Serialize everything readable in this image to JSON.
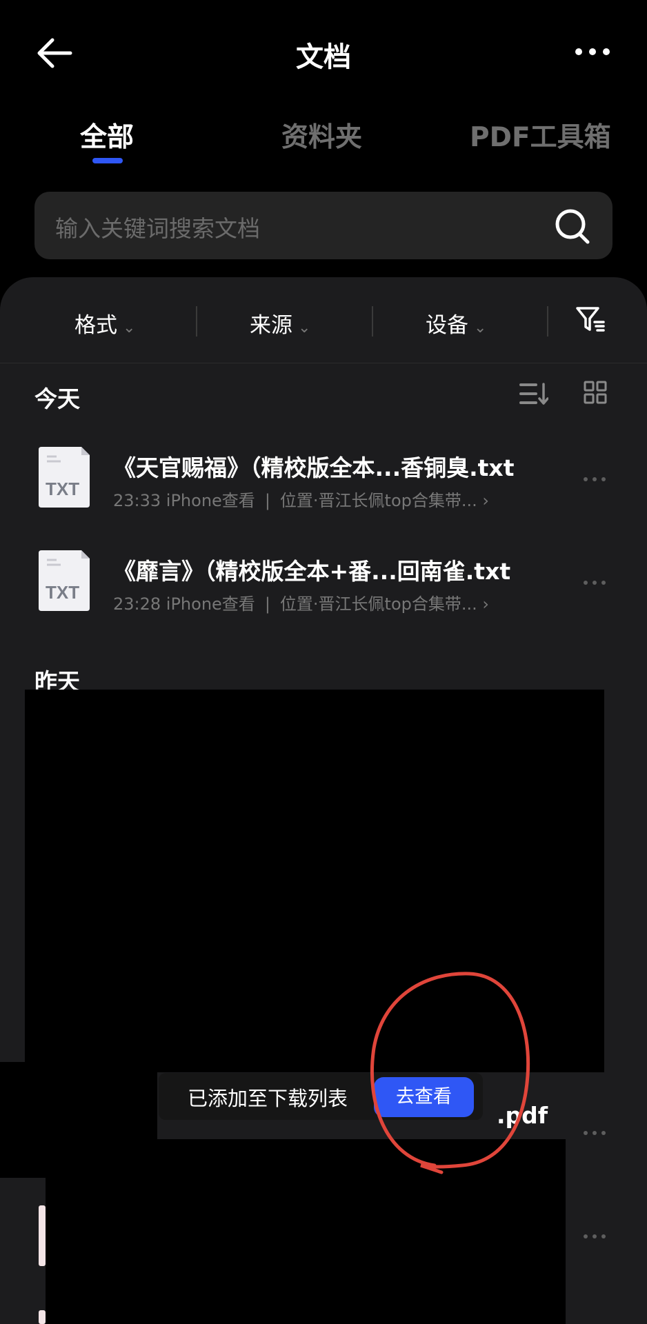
{
  "header": {
    "title": "文档",
    "back_icon": "arrow-left-icon",
    "more_icon": "more-horizontal-icon"
  },
  "tabs": [
    {
      "label": "全部",
      "active": true
    },
    {
      "label": "资料夹",
      "active": false
    },
    {
      "label": "PDF工具箱",
      "active": false
    }
  ],
  "search": {
    "placeholder": "输入关键词搜索文档",
    "icon": "search-icon"
  },
  "filters": [
    {
      "label": "格式",
      "icon": "chevron-down-icon"
    },
    {
      "label": "来源",
      "icon": "chevron-down-icon"
    },
    {
      "label": "设备",
      "icon": "chevron-down-icon"
    }
  ],
  "filter_icon": "filter-icon",
  "sections": {
    "today": "今天",
    "yesterday": "昨天"
  },
  "view_icons": [
    "sort-icon",
    "grid-view-icon"
  ],
  "files": [
    {
      "icon_label": "TXT",
      "name": "《天官赐福》（精校版全本...香铜臭.txt",
      "meta": "23:33 iPhone查看",
      "location": "位置·晋江长佩top合集带... ›"
    },
    {
      "icon_label": "TXT",
      "name": "《靡言》（精校版全本+番...回南雀.txt",
      "meta": "23:28 iPhone查看",
      "location": "位置·晋江长佩top合集带... ›"
    }
  ],
  "partial_file_suffix": ".pdf",
  "toast": {
    "text": "已添加至下载列表",
    "button": "去查看"
  },
  "colors": {
    "accent": "#2f57f5",
    "annotation": "#e0453a",
    "background": "#000000",
    "panel": "#1c1c1e"
  }
}
